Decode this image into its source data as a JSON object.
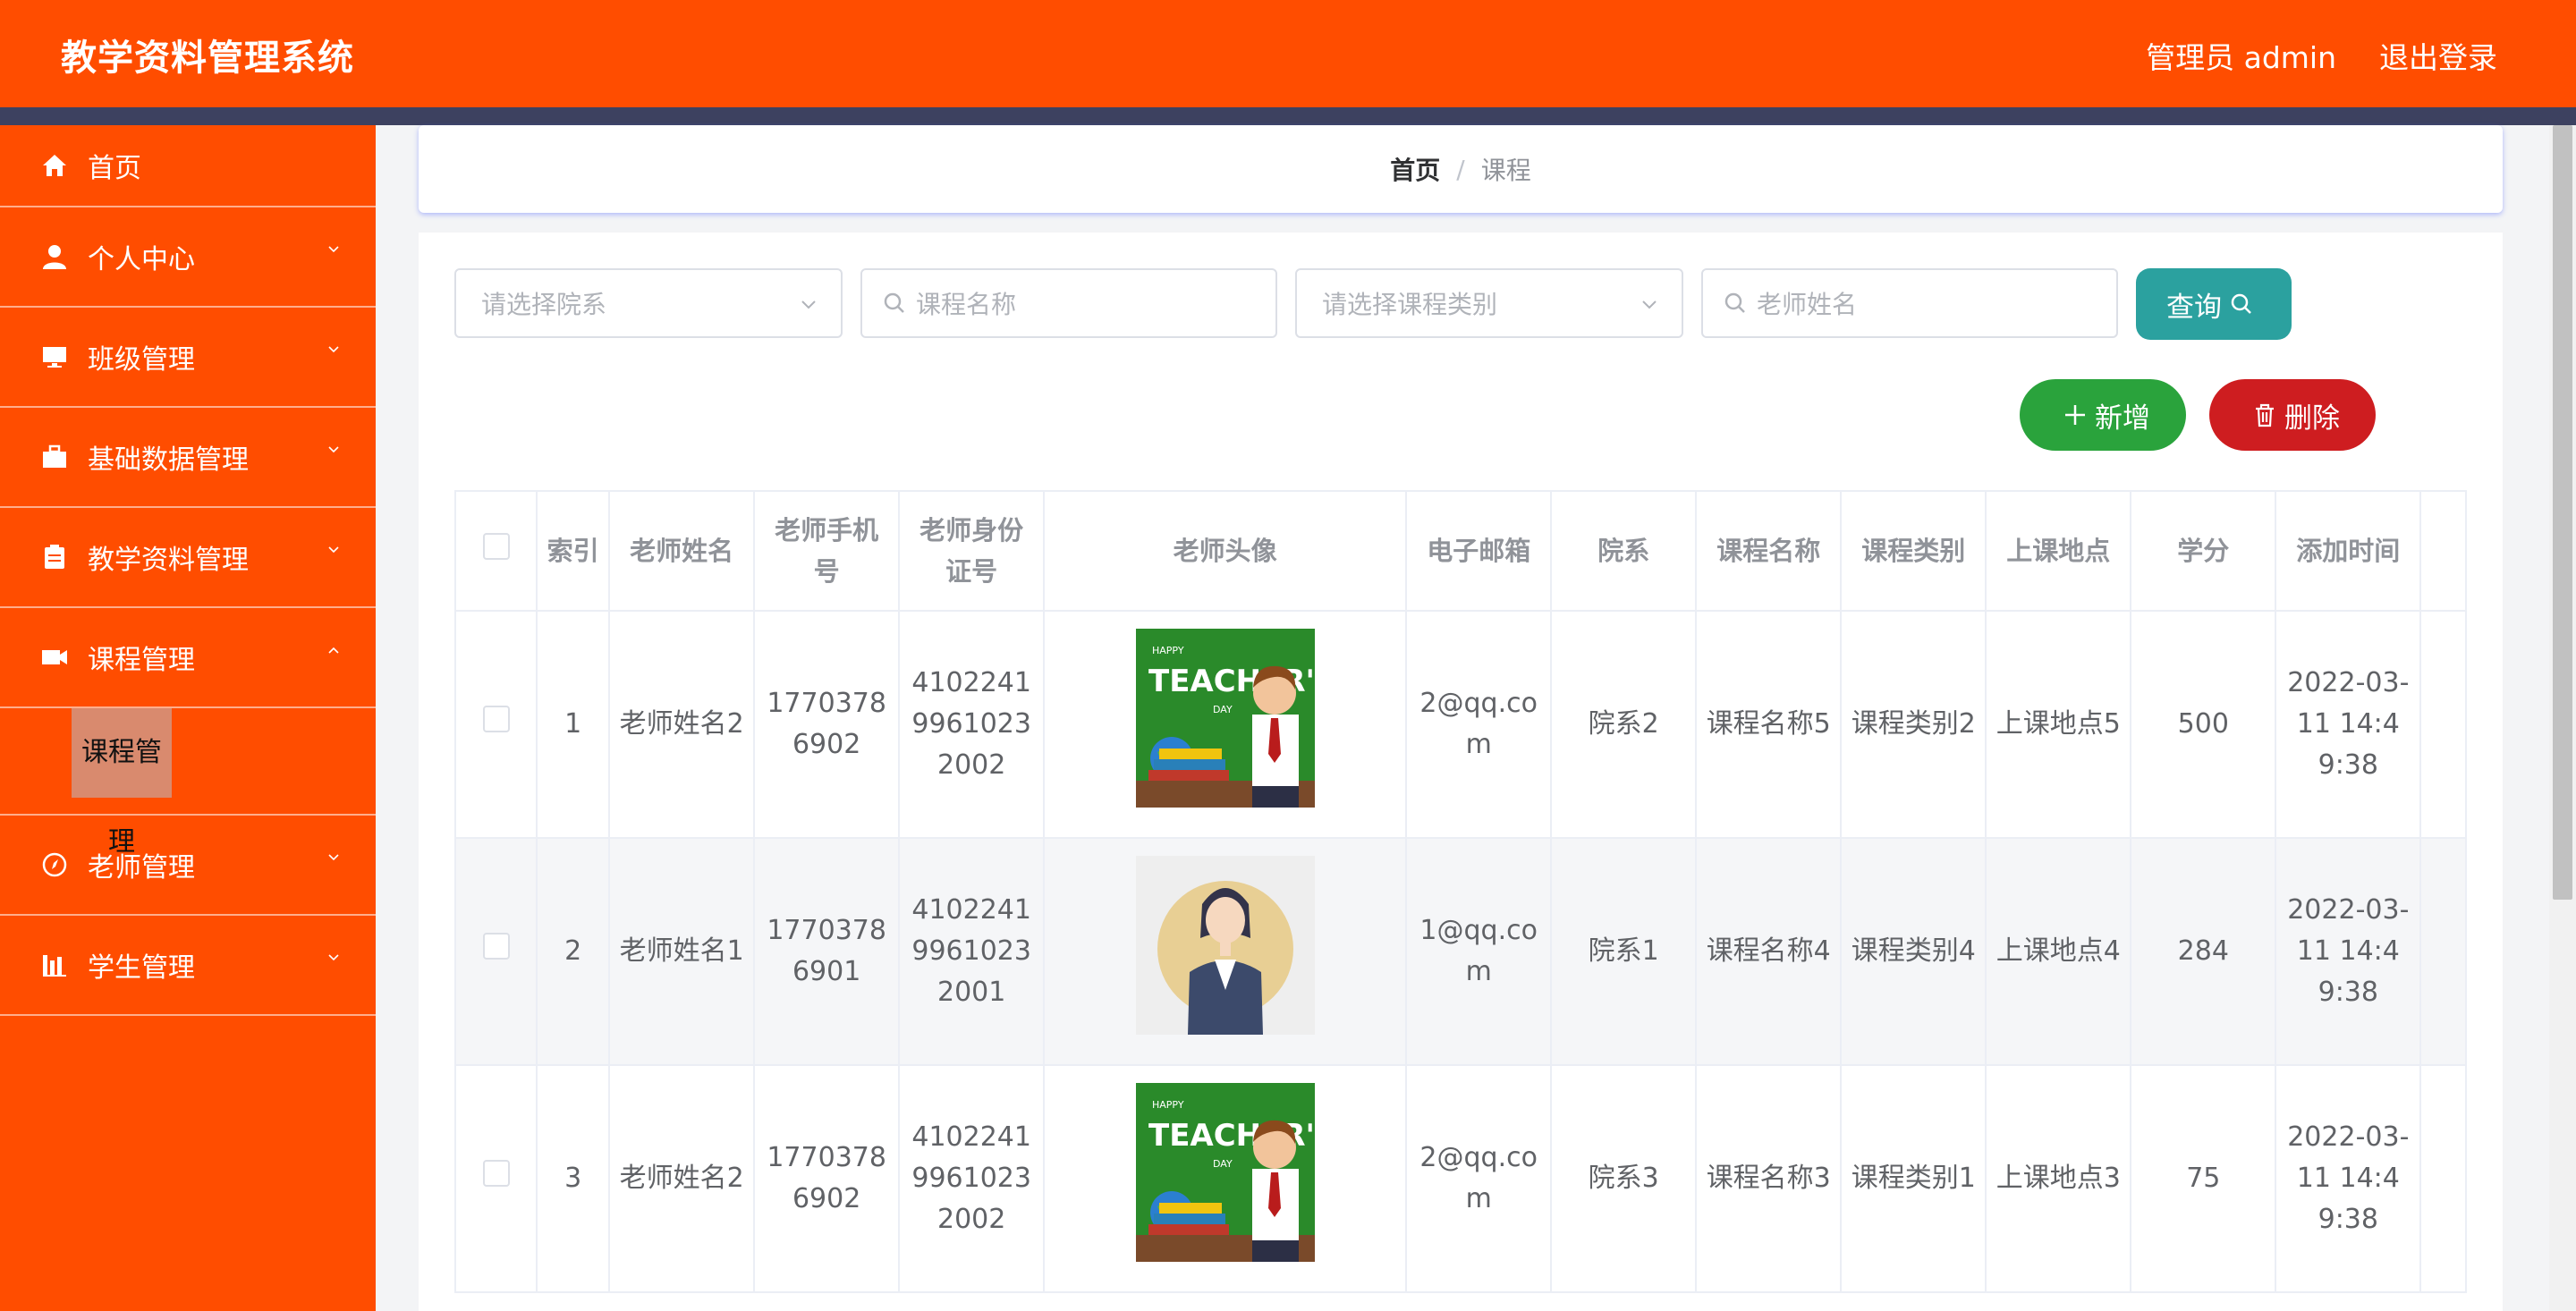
{
  "header": {
    "title": "教学资料管理系统",
    "user": "管理员 admin",
    "logout": "退出登录"
  },
  "sidebar": {
    "items": [
      {
        "label": "首页",
        "icon": "home-icon"
      },
      {
        "label": "个人中心",
        "icon": "user-icon"
      },
      {
        "label": "班级管理",
        "icon": "monitor-icon"
      },
      {
        "label": "基础数据管理",
        "icon": "briefcase-icon"
      },
      {
        "label": "教学资料管理",
        "icon": "clipboard-icon"
      },
      {
        "label": "课程管理",
        "icon": "camera-icon"
      },
      {
        "label": "老师管理",
        "icon": "compass-icon"
      },
      {
        "label": "学生管理",
        "icon": "chart-icon"
      }
    ],
    "active_sub": "课程管理"
  },
  "breadcrumb": {
    "home": "首页",
    "sep": "/",
    "current": "课程"
  },
  "filters": {
    "department_placeholder": "请选择院系",
    "course_name_placeholder": "课程名称",
    "course_type_placeholder": "请选择课程类别",
    "teacher_name_placeholder": "老师姓名"
  },
  "buttons": {
    "query": "查询",
    "add": "新增",
    "delete": "删除"
  },
  "table": {
    "headers": [
      "索引",
      "老师姓名",
      "老师手机号",
      "老师身份证号",
      "老师头像",
      "电子邮箱",
      "院系",
      "课程名称",
      "课程类别",
      "上课地点",
      "学分",
      "添加时间"
    ],
    "rows": [
      {
        "index": "1",
        "name": "老师姓名2",
        "phone": "17703786902",
        "id_card": "410224199610232002",
        "avatar": "teachers-day-avatar",
        "email": "2@qq.com",
        "department": "院系2",
        "course_name": "课程名称5",
        "course_type": "课程类别2",
        "location": "上课地点5",
        "credit": "500",
        "time": "2022-03-11 14:49:38"
      },
      {
        "index": "2",
        "name": "老师姓名1",
        "phone": "17703786901",
        "id_card": "410224199610232001",
        "avatar": "female-teacher-avatar",
        "email": "1@qq.com",
        "department": "院系1",
        "course_name": "课程名称4",
        "course_type": "课程类别4",
        "location": "上课地点4",
        "credit": "284",
        "time": "2022-03-11 14:49:38"
      },
      {
        "index": "3",
        "name": "老师姓名2",
        "phone": "17703786902",
        "id_card": "410224199610232002",
        "avatar": "teachers-day-avatar",
        "email": "2@qq.com",
        "department": "院系3",
        "course_name": "课程名称3",
        "course_type": "课程类别1",
        "location": "上课地点3",
        "credit": "75",
        "time": "2022-03-11 14:49:38"
      }
    ]
  },
  "avatar_art": {
    "teachers_day_line1": "HAPPY",
    "teachers_day_line2": "TEACHER'S",
    "teachers_day_line3": "DAY"
  },
  "colors": {
    "primary": "#ff4d00",
    "header_stripe": "#3d4160",
    "query": "#2ba19f",
    "add": "#2aa33c",
    "delete": "#ce1d20"
  }
}
